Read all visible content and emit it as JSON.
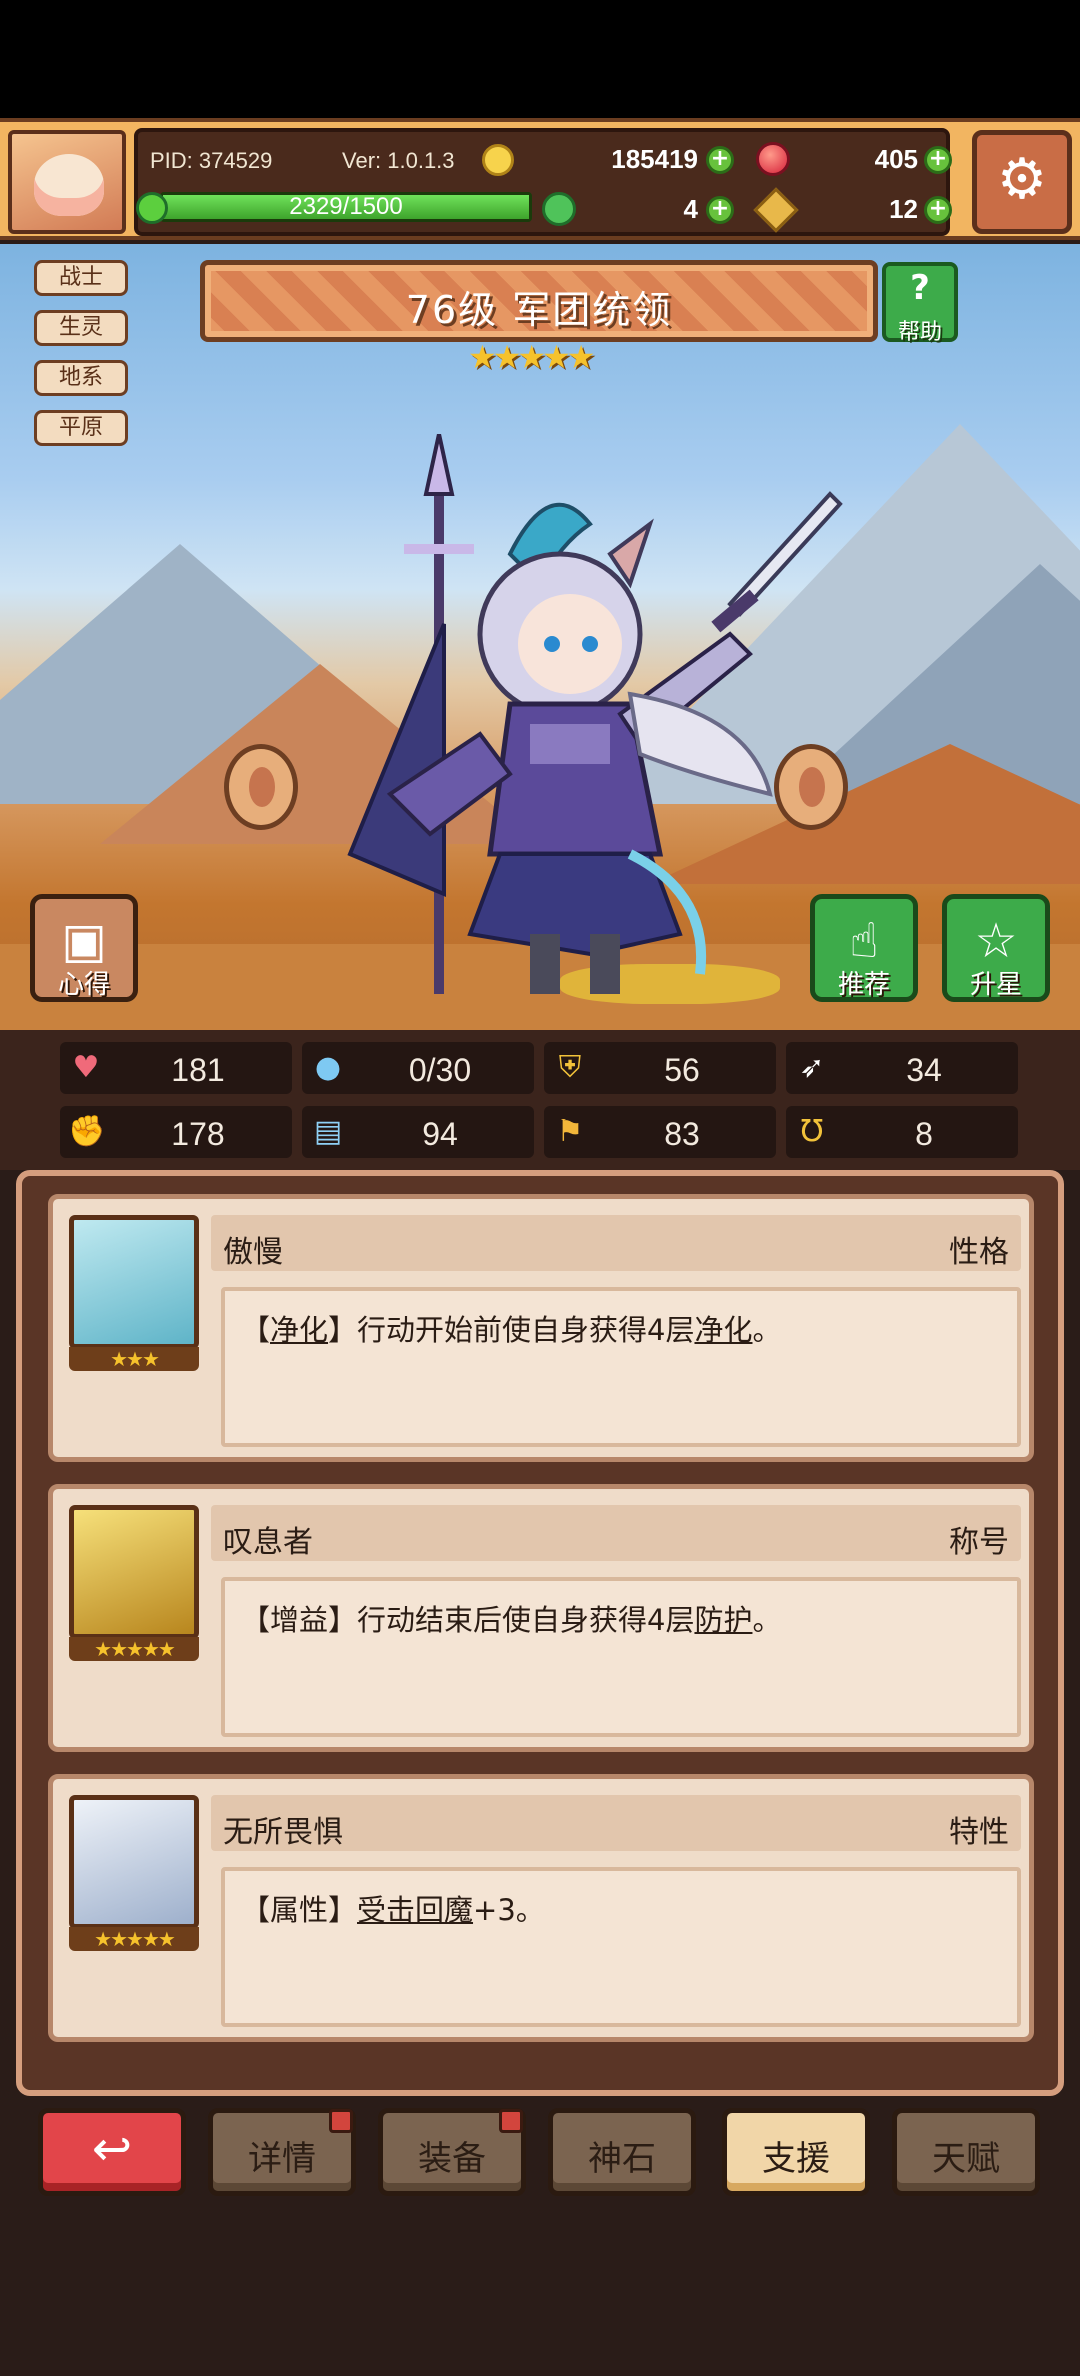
{
  "hud": {
    "pid": "PID: 374529",
    "version": "Ver: 1.0.1.3",
    "gold": "185419",
    "gems": "405",
    "xp_text": "2329/1500",
    "xp_fill": 1.0,
    "clover": "4",
    "keys": "12"
  },
  "hero": {
    "tags": [
      "战士",
      "生灵",
      "地系",
      "平原"
    ],
    "title": "76级  军团统领",
    "stars": "★★★★★",
    "help_label": "帮助",
    "help_icon": "?",
    "left_button": "心得",
    "recommend_button": "推荐",
    "upgrade_button": "升星"
  },
  "stats": [
    {
      "icon": "heart-icon",
      "glyph": "♥",
      "color": "#f06a7a",
      "value": "181"
    },
    {
      "icon": "mana-drop-icon",
      "glyph": "●",
      "color": "#7ec9f2",
      "value": "0/30"
    },
    {
      "icon": "shield-icon",
      "glyph": "⛨",
      "color": "#f2c23a",
      "value": "56"
    },
    {
      "icon": "wing-icon",
      "glyph": "➶",
      "color": "#ffffff",
      "value": "34"
    },
    {
      "icon": "fist-icon",
      "glyph": "✊",
      "color": "#f08a8a",
      "value": "178"
    },
    {
      "icon": "book-icon",
      "glyph": "▤",
      "color": "#8fd0f5",
      "value": "94"
    },
    {
      "icon": "flag-icon",
      "glyph": "⚑",
      "color": "#f2b63a",
      "value": "83"
    },
    {
      "icon": "horseshoe-icon",
      "glyph": "Ʊ",
      "color": "#f2c23a",
      "value": "8"
    }
  ],
  "cards": [
    {
      "name": "傲慢",
      "type": "性格",
      "stars": "★★★",
      "desc_pre": "【",
      "desc_link1": "净化",
      "desc_mid": "】行动开始前使自身获得4层",
      "desc_link2": "净化",
      "desc_post": "。",
      "portrait_color": "#8fd6e0"
    },
    {
      "name": "叹息者",
      "type": "称号",
      "stars": "★★★★★",
      "desc_pre": "【增益】行动结束后使自身获得4层",
      "desc_link1": "防护",
      "desc_mid": "。",
      "desc_link2": "",
      "desc_post": "",
      "portrait_color": "#e6c14a"
    },
    {
      "name": "无所畏惧",
      "type": "特性",
      "stars": "★★★★★",
      "desc_pre": "【属性】",
      "desc_link1": "受击回魔",
      "desc_mid": "+3。",
      "desc_link2": "",
      "desc_post": "",
      "portrait_color": "#cfd8e8"
    }
  ],
  "tabs": [
    {
      "label": "↩",
      "kind": "back",
      "dot": false
    },
    {
      "label": "详情",
      "kind": "normal",
      "dot": true
    },
    {
      "label": "装备",
      "kind": "normal",
      "dot": true
    },
    {
      "label": "神石",
      "kind": "normal",
      "dot": false
    },
    {
      "label": "支援",
      "kind": "active",
      "dot": false
    },
    {
      "label": "天赋",
      "kind": "normal",
      "dot": false
    }
  ]
}
